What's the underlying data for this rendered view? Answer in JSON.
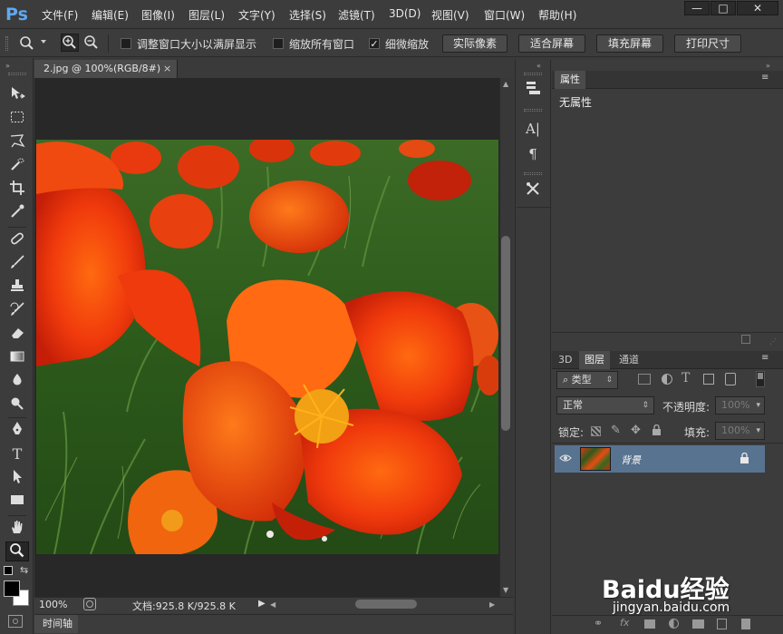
{
  "app": {
    "logo": "Ps"
  },
  "menu": [
    "文件(F)",
    "编辑(E)",
    "图像(I)",
    "图层(L)",
    "文字(Y)",
    "选择(S)",
    "滤镜(T)",
    "3D(D)",
    "视图(V)",
    "窗口(W)",
    "帮助(H)"
  ],
  "window_controls": {
    "minimize": "—",
    "maximize": "□",
    "close": "✕"
  },
  "options_bar": {
    "resize_windows_label": "调整窗口大小以满屏显示",
    "resize_windows_checked": false,
    "zoom_all_windows_label": "缩放所有窗口",
    "zoom_all_windows_checked": false,
    "scrubby_zoom_label": "细微缩放",
    "scrubby_zoom_checked": true,
    "actual_pixels_label": "实际像素",
    "fit_screen_label": "适合屏幕",
    "fill_screen_label": "填充屏幕",
    "print_size_label": "打印尺寸",
    "check_mark": "✓"
  },
  "document": {
    "tab_title": "2.jpg @ 100%(RGB/8#)",
    "tab_close": "×",
    "zoom": "100%",
    "doc_info": "文档:925.8 K/925.8 K"
  },
  "timeline": {
    "label": "时间轴"
  },
  "properties_panel": {
    "tab_label": "属性",
    "empty_text": "无属性"
  },
  "layers_panel": {
    "tabs": [
      "3D",
      "图层",
      "通道"
    ],
    "selected_tab": "图层",
    "filter_label": "类型",
    "blend_mode": "正常",
    "opacity_label": "不透明度:",
    "opacity_value": "100%",
    "lock_label": "锁定:",
    "fill_label": "填充:",
    "fill_value": "100%",
    "layers": [
      {
        "name": "背景",
        "visible": true,
        "locked": true
      }
    ]
  },
  "watermark": {
    "brand": "Baidu经验",
    "url": "jingyan.baidu.com"
  },
  "colors": {
    "accent_logo": "#5fa8f2",
    "selected_layer": "#587390",
    "panel_bg": "#3c3c3c",
    "canvas_bg": "#282828"
  }
}
